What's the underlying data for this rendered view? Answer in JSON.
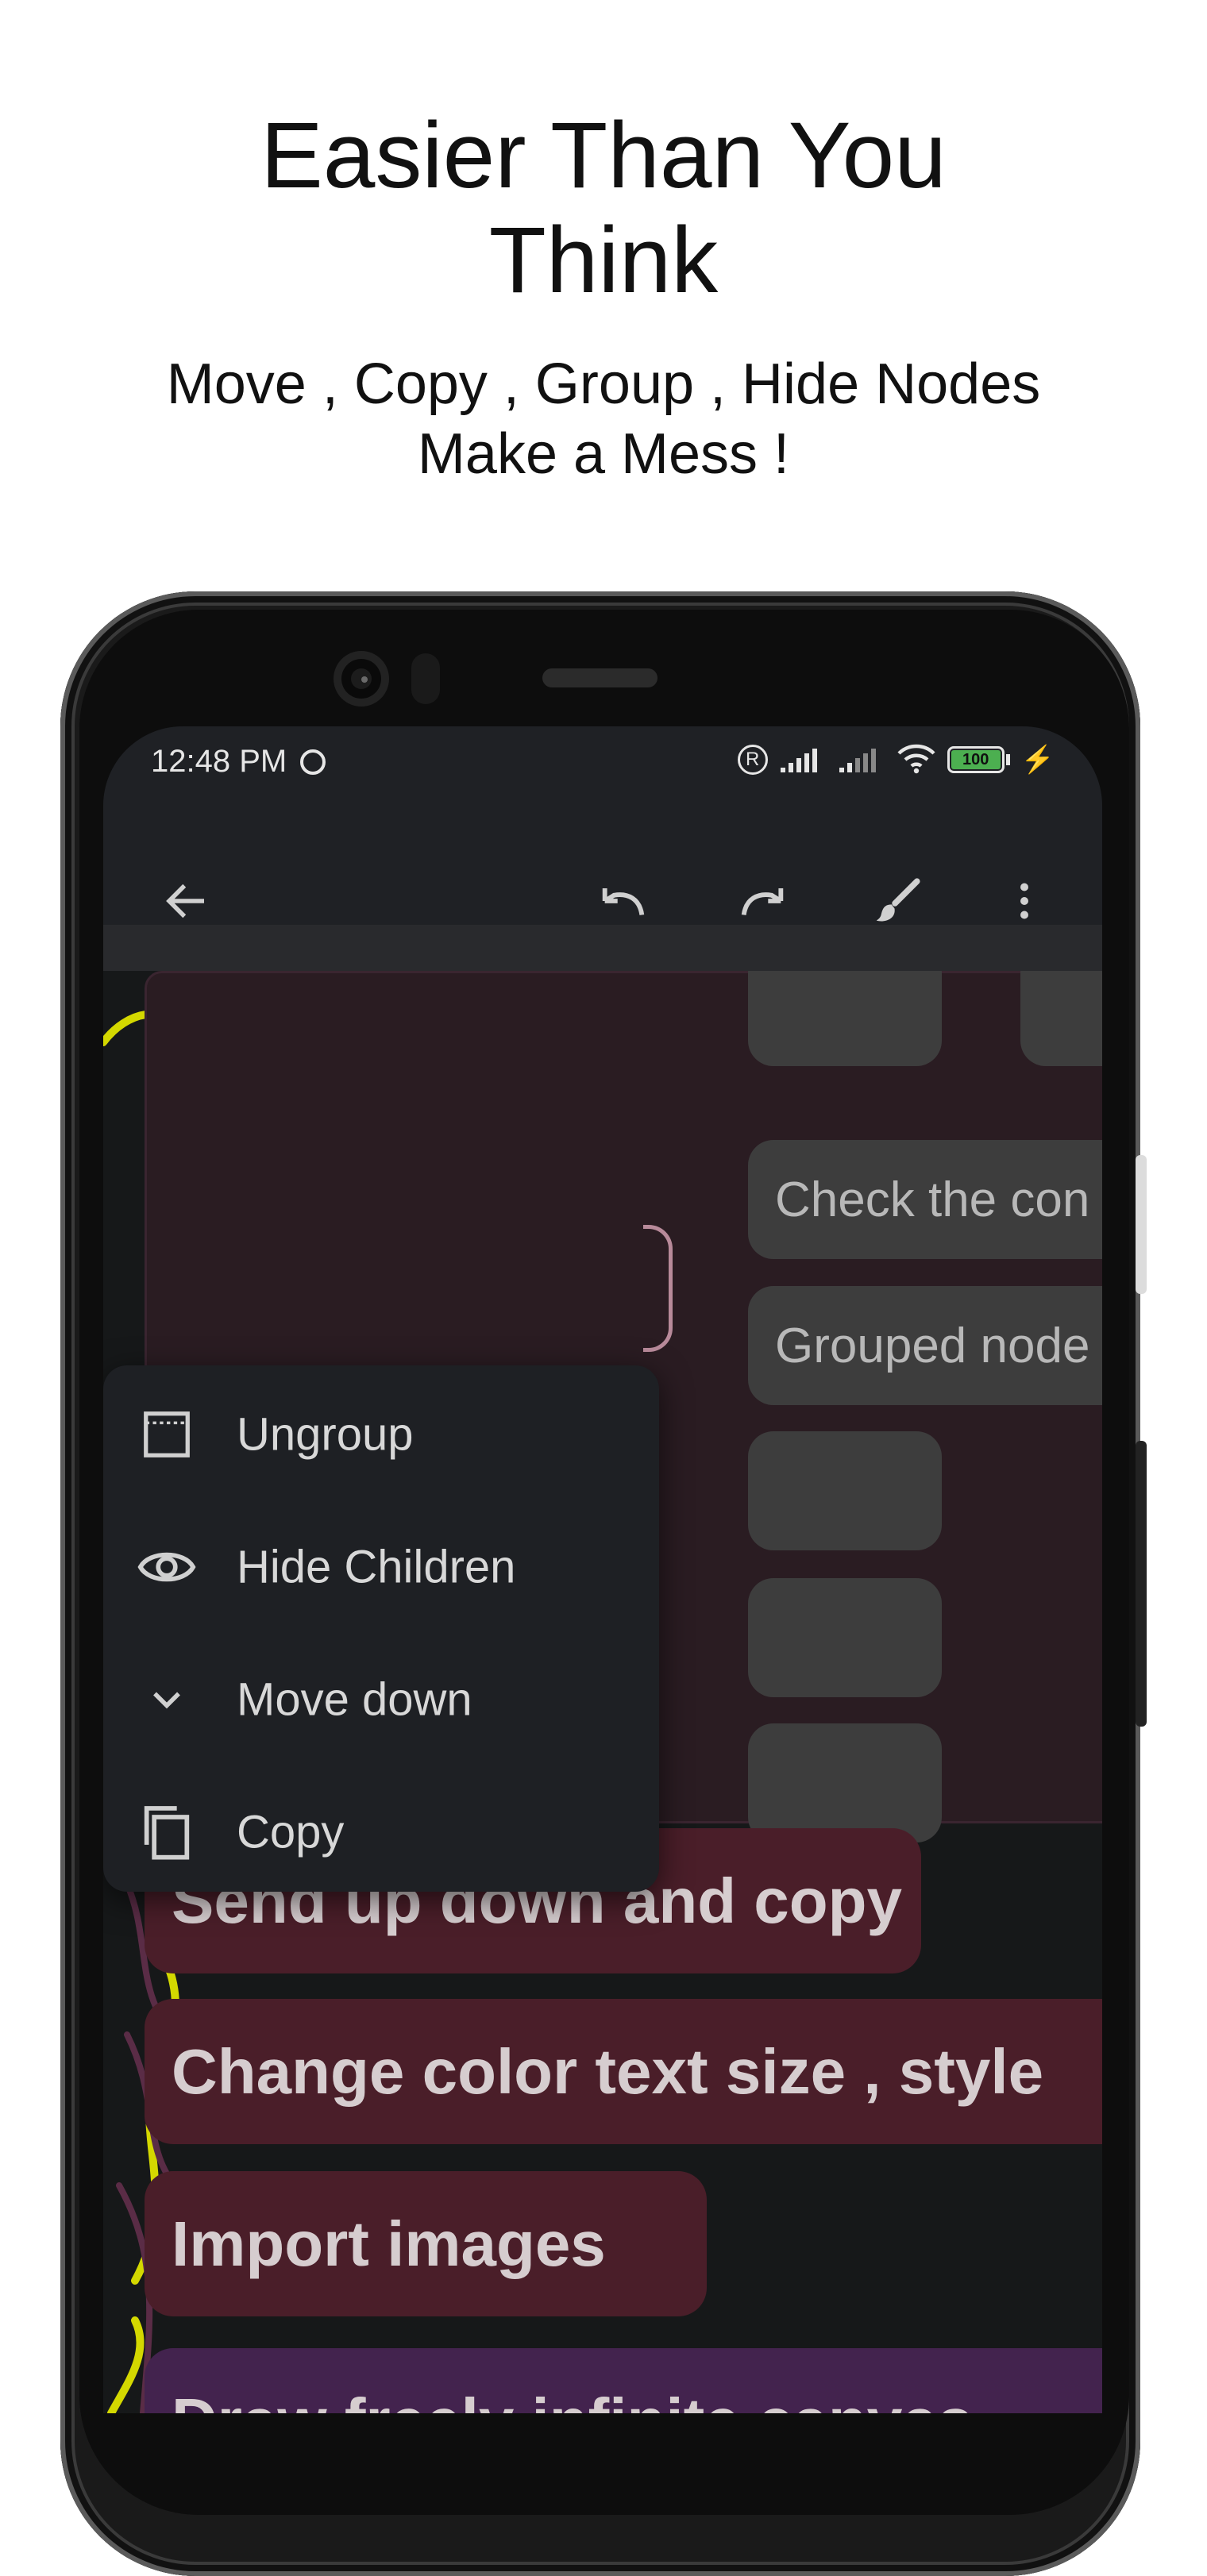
{
  "promo": {
    "title_line1": "Easier Than You",
    "title_line2": "Think",
    "subtitle_line1": "Move , Copy , Group , Hide Nodes",
    "subtitle_line2": "Make a Mess !"
  },
  "statusbar": {
    "time": "12:48 PM",
    "battery": "100"
  },
  "toolbar": {
    "back_icon": "arrow-back-icon",
    "undo_icon": "undo-icon",
    "redo_icon": "redo-icon",
    "brush_icon": "brush-icon",
    "more_icon": "more-vert-icon"
  },
  "group_nodes": [
    {
      "label": ""
    },
    {
      "label": "Check the con"
    },
    {
      "label": "Grouped node"
    },
    {
      "label": ""
    },
    {
      "label": ""
    },
    {
      "label": ""
    }
  ],
  "menu": {
    "items": [
      {
        "label": "Ungroup",
        "icon": "ungroup-icon"
      },
      {
        "label": "Hide Children",
        "icon": "eye-icon"
      },
      {
        "label": "Move down",
        "icon": "chevron-down-icon"
      },
      {
        "label": "Copy",
        "icon": "copy-icon"
      }
    ]
  },
  "nodes": [
    {
      "label": "Send up down and copy"
    },
    {
      "label": "Change color text size , style"
    },
    {
      "label": "Import images"
    },
    {
      "label": "Draw freely infinite canvas"
    }
  ],
  "colors": {
    "group_bg": "#2a1c22",
    "node_red": "#4a1e29",
    "node_purple": "#43234e",
    "doodle_yellow": "#d4d800",
    "menu_bg": "#1e2024"
  }
}
